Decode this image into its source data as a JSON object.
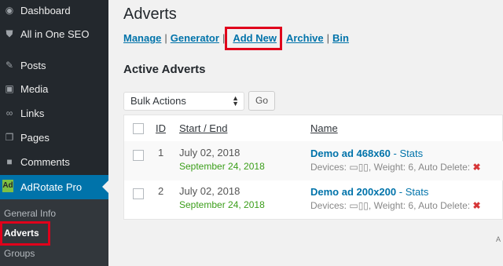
{
  "sidebar": {
    "items": [
      {
        "label": "Dashboard",
        "icon": "dashboard-icon"
      },
      {
        "label": "All in One SEO",
        "icon": "seo-shield-icon"
      },
      {
        "label": "Posts",
        "icon": "pin-icon"
      },
      {
        "label": "Media",
        "icon": "media-icon"
      },
      {
        "label": "Links",
        "icon": "link-icon"
      },
      {
        "label": "Pages",
        "icon": "pages-icon"
      },
      {
        "label": "Comments",
        "icon": "comment-icon"
      },
      {
        "label": "AdRotate Pro",
        "icon": "adrotate-icon",
        "badge": "Ad",
        "active": true
      }
    ],
    "submenu": [
      "General Info",
      "Adverts",
      "Groups"
    ],
    "current_submenu": "Adverts"
  },
  "main": {
    "title": "Adverts",
    "subnav": {
      "links": [
        "Manage",
        "Generator",
        "Add New",
        "Archive",
        "Bin"
      ],
      "separator": "|"
    },
    "section_title": "Active Adverts",
    "bulk_actions": {
      "selected": "Bulk Actions",
      "button": "Go"
    },
    "table": {
      "columns": [
        "ID",
        "Start / End",
        "Name"
      ],
      "rows": [
        {
          "id": "1",
          "start": "July 02, 2018",
          "end": "September 24, 2018",
          "name": "Demo ad 468x60",
          "stats": "- Stats",
          "devices_label": "Devices:",
          "weight": "Weight: 6",
          "auto_delete": "Auto Delete:",
          "auto_delete_icon": "✖"
        },
        {
          "id": "2",
          "start": "July 02, 2018",
          "end": "September 24, 2018",
          "name": "Demo ad 200x200",
          "stats": "- Stats",
          "devices_label": "Devices:",
          "weight": "Weight: 6",
          "auto_delete": "Auto Delete:",
          "auto_delete_icon": "✖"
        }
      ]
    },
    "footer_fragment": "A"
  },
  "colors": {
    "sidebar_bg": "#23282d",
    "active_bg": "#0073aa",
    "link": "#0073aa",
    "highlight": "#e0001b",
    "date_end": "#3b9e1a"
  }
}
